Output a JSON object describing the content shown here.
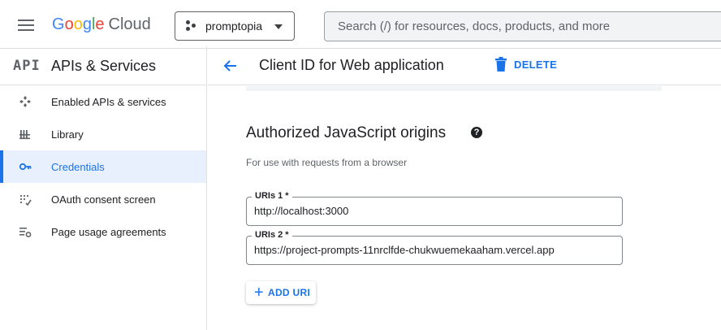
{
  "header": {
    "logo": [
      "G",
      "o",
      "o",
      "g",
      "l",
      "e"
    ],
    "logo_suffix": "Cloud",
    "project": "promptopia",
    "search_placeholder": "Search (/) for resources, docs, products, and more"
  },
  "sidebar": {
    "logo_text": "API",
    "title": "APIs & Services",
    "items": [
      {
        "label": "Enabled APIs & services",
        "icon": "enabled-apis-icon"
      },
      {
        "label": "Library",
        "icon": "library-icon"
      },
      {
        "label": "Credentials",
        "icon": "key-icon",
        "active": true
      },
      {
        "label": "OAuth consent screen",
        "icon": "oauth-icon"
      },
      {
        "label": "Page usage agreements",
        "icon": "settings-list-icon"
      }
    ]
  },
  "main": {
    "title": "Client ID for Web application",
    "delete_label": "DELETE",
    "section_title": "Authorized JavaScript origins",
    "help_glyph": "?",
    "hint": "For use with requests from a browser",
    "uris": [
      {
        "label": "URIs 1 *",
        "value": "http://localhost:3000"
      },
      {
        "label": "URIs 2 *",
        "value": "https://project-prompts-11nrclfde-chukwuemekaaham.vercel.app"
      }
    ],
    "add_uri_label": "ADD URI",
    "add_uri_glyph": "+"
  },
  "colors": {
    "accent": "#1a73e8",
    "active_bg": "#e8f0fe",
    "text": "#202124",
    "muted": "#5f6368"
  }
}
